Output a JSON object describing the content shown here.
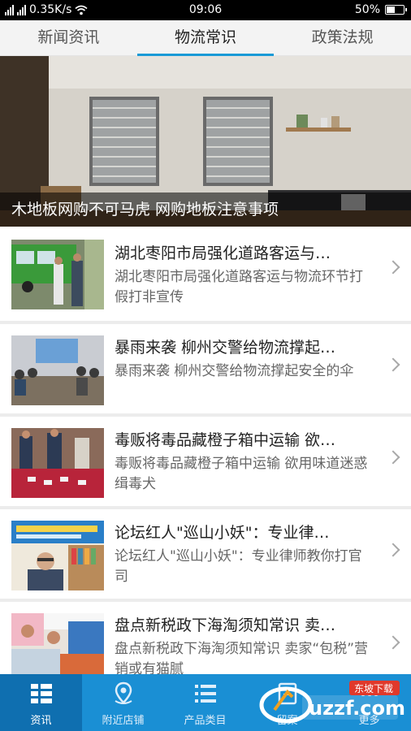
{
  "status_bar": {
    "network": "0.35K/s",
    "time": "09:06",
    "battery_text": "50%",
    "battery_level": 0.5
  },
  "tabs": [
    {
      "label": "新闻资讯",
      "active": false
    },
    {
      "label": "物流常识",
      "active": true
    },
    {
      "label": "政策法规",
      "active": false
    }
  ],
  "hero": {
    "caption": "木地板网购不可马虎 网购地板注意事项"
  },
  "news": [
    {
      "title": "湖北枣阳市局强化道路客运与…",
      "summary": "湖北枣阳市局强化道路客运与物流环节打假打非宣传"
    },
    {
      "title": "暴雨来袭 柳州交警给物流撑起…",
      "summary": "暴雨来袭 柳州交警给物流撑起安全的伞"
    },
    {
      "title": "毒贩将毒品藏橙子箱中运输 欲…",
      "summary": "毒贩将毒品藏橙子箱中运输 欲用味道迷惑缉毒犬"
    },
    {
      "title": "论坛红人\"巡山小妖\"：专业律…",
      "summary": "论坛红人\"巡山小妖\"：专业律师教你打官司"
    },
    {
      "title": "盘点新税政下海淘须知常识 卖…",
      "summary": "盘点新税政下海淘须知常识 卖家“包税”营销或有猫腻"
    }
  ],
  "bottom_nav": [
    {
      "label": "资讯",
      "icon": "news-list-icon",
      "active": true
    },
    {
      "label": "附近店铺",
      "icon": "location-pin-icon",
      "active": false
    },
    {
      "label": "产品类目",
      "icon": "category-list-icon",
      "active": false
    },
    {
      "label": "留案",
      "icon": "archive-icon",
      "active": false
    },
    {
      "label": "更多",
      "icon": "more-icon",
      "active": false
    }
  ],
  "watermark": {
    "brand": "uzzf.com",
    "tag": "东坡下载"
  },
  "colors": {
    "accent": "#1a9ad6",
    "nav_bg": "#1a8fd4",
    "nav_active": "#0f6fb0"
  }
}
